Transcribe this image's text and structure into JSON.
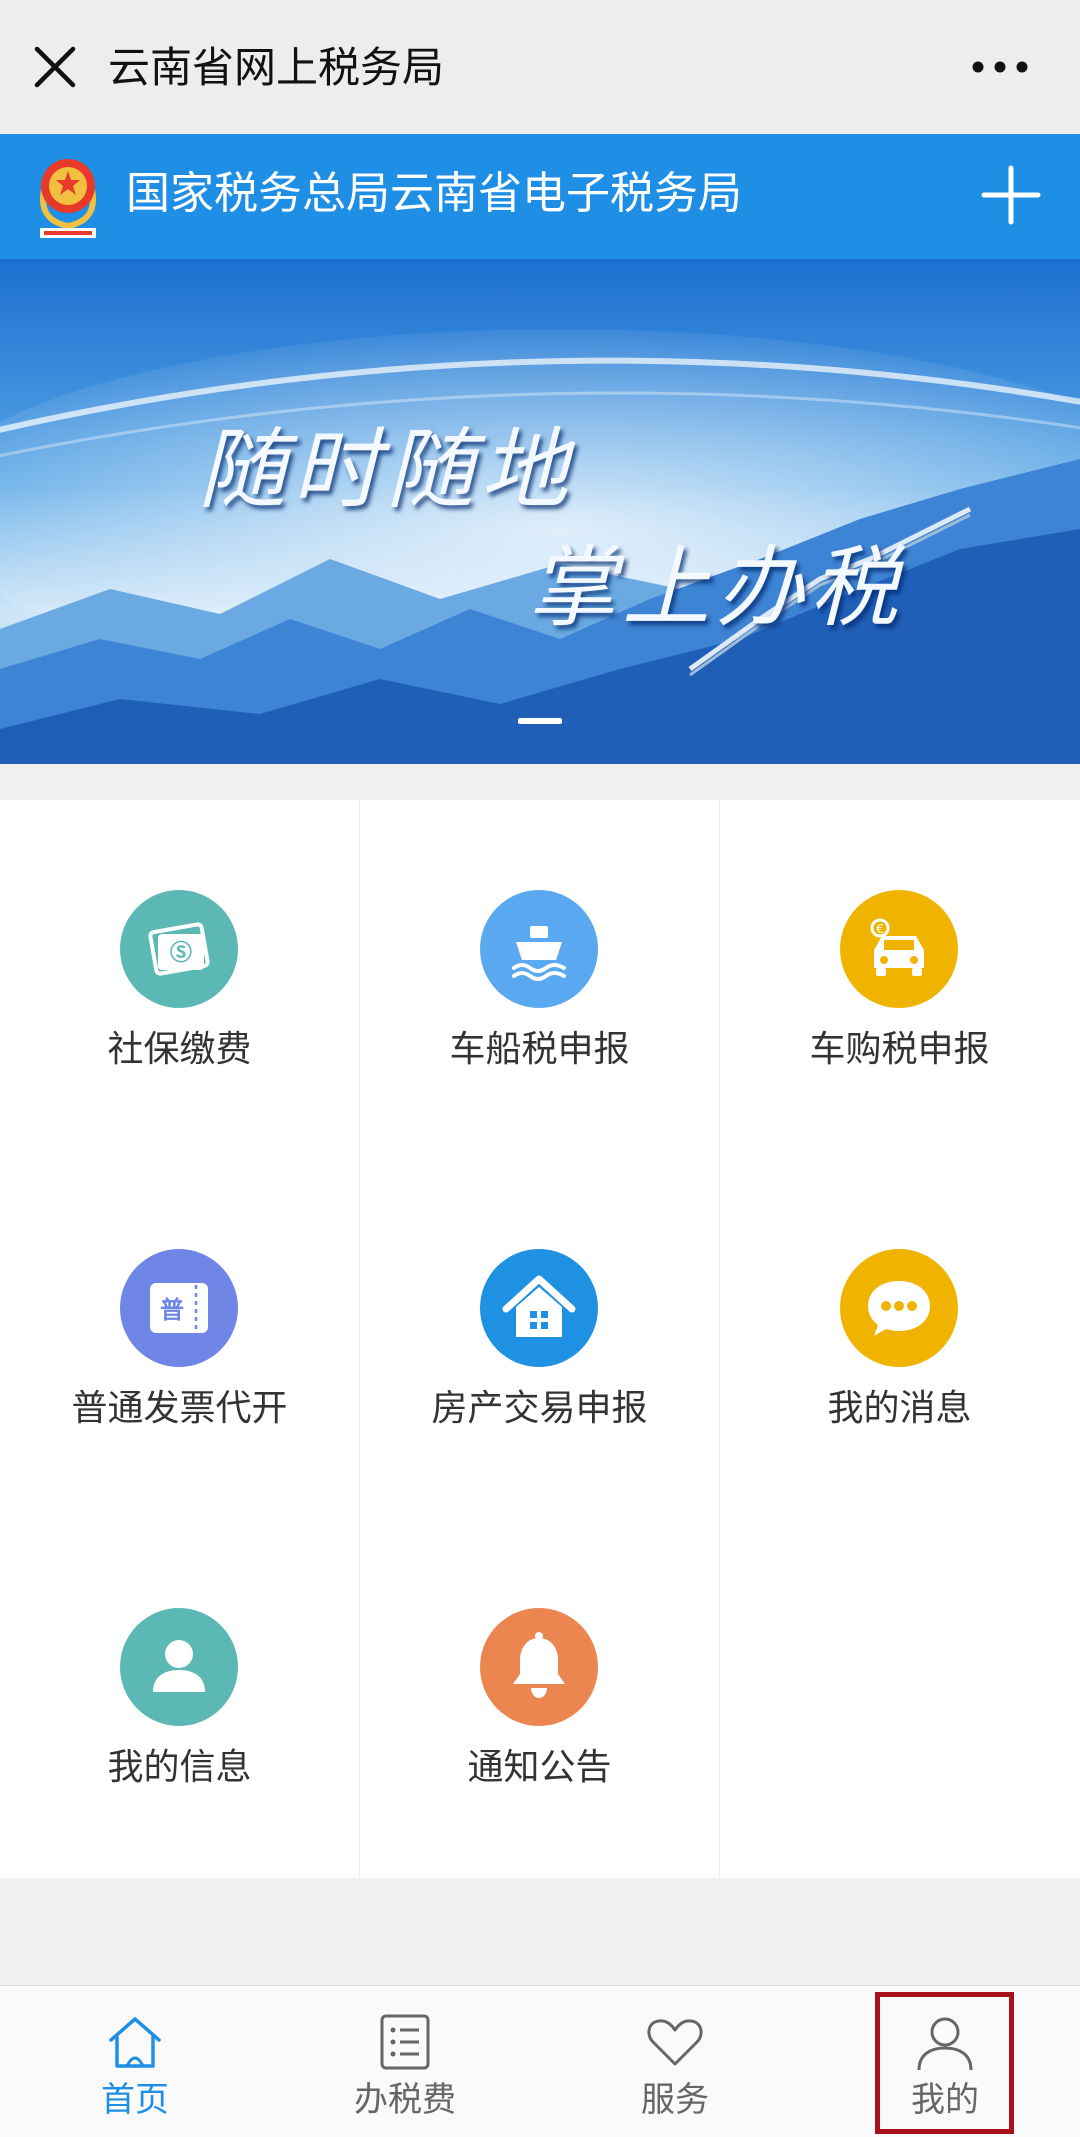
{
  "window": {
    "title": "云南省网上税务局"
  },
  "header": {
    "title": "国家税务总局云南省电子税务局"
  },
  "banner": {
    "line1": "随时随地",
    "line2": "掌上办税"
  },
  "services": [
    {
      "label": "社保缴费",
      "icon": "social-security-card-icon",
      "color": "#5bb8b4"
    },
    {
      "label": "车船税申报",
      "icon": "ship-icon",
      "color": "#5aa8ef"
    },
    {
      "label": "车购税申报",
      "icon": "car-icon",
      "color": "#f0b400"
    },
    {
      "label": "普通发票代开",
      "icon": "invoice-icon",
      "color": "#6f86e6"
    },
    {
      "label": "房产交易申报",
      "icon": "house-icon",
      "color": "#1f91e3"
    },
    {
      "label": "我的消息",
      "icon": "chat-bubble-icon",
      "color": "#f0b400"
    },
    {
      "label": "我的信息",
      "icon": "user-icon",
      "color": "#5bb8b4"
    },
    {
      "label": "通知公告",
      "icon": "bell-icon",
      "color": "#ec8650"
    }
  ],
  "invoice_icon_glyph": "普",
  "tabs": [
    {
      "label": "首页",
      "icon": "home-icon",
      "active": true
    },
    {
      "label": "办税费",
      "icon": "list-icon",
      "active": false
    },
    {
      "label": "服务",
      "icon": "heart-icon",
      "active": false
    },
    {
      "label": "我的",
      "icon": "person-icon",
      "active": false
    }
  ],
  "colors": {
    "brand_blue": "#1f8fe6",
    "highlight_box": "#a8121c"
  }
}
